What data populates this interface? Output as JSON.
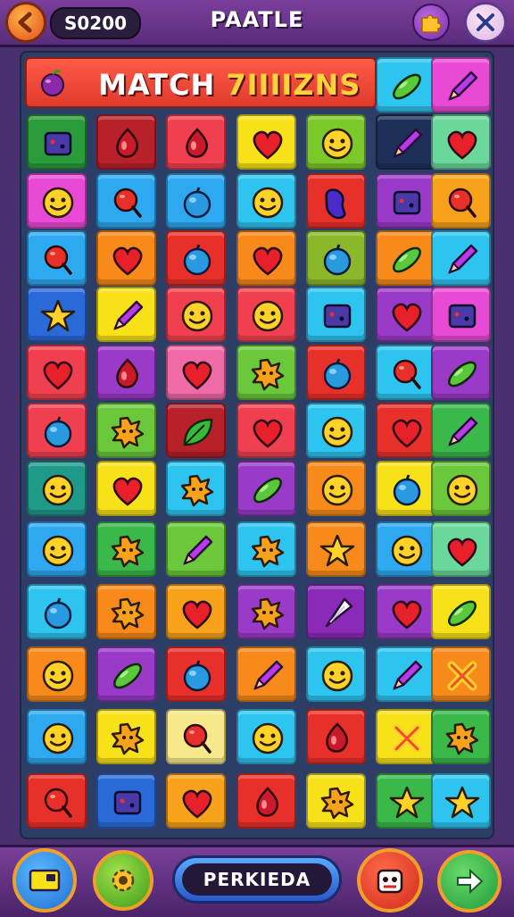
{
  "header": {
    "score": "S0200",
    "title": "PAATLE"
  },
  "banner": {
    "text_main": "MATCH",
    "text_sub": "7IIIIZNS"
  },
  "footer": {
    "pill_label": "PERKIEDA"
  },
  "board": {
    "rows": [
      [
        null,
        null,
        null,
        null,
        null,
        {
          "bg": "#2ec4f0",
          "icon": "pickle"
        },
        {
          "bg": "#e84ad6",
          "icon": "pencil"
        }
      ],
      [
        {
          "bg": "#2a9a3a",
          "icon": "box"
        },
        {
          "bg": "#b8202a",
          "icon": "drop"
        },
        {
          "bg": "#f04050",
          "icon": "drop"
        },
        {
          "bg": "#f7e21a",
          "icon": "heart"
        },
        {
          "bg": "#7ac82a",
          "icon": "smiley"
        },
        {
          "bg": "#1e2f5a",
          "icon": "pencil"
        },
        {
          "bg": "#6ad89a",
          "icon": "heart"
        }
      ],
      [
        {
          "bg": "#e84ad6",
          "icon": "smiley"
        },
        {
          "bg": "#2ea8f0",
          "icon": "lollipop"
        },
        {
          "bg": "#2ea8f0",
          "icon": "ball"
        },
        {
          "bg": "#2ec4f0",
          "icon": "smiley"
        },
        {
          "bg": "#e8302a",
          "icon": "bean"
        },
        {
          "bg": "#9a3ac8",
          "icon": "box"
        },
        {
          "bg": "#f7a21a",
          "icon": "lollipop"
        }
      ],
      [
        {
          "bg": "#2ea8f0",
          "icon": "lollipop"
        },
        {
          "bg": "#f78a1a",
          "icon": "heart"
        },
        {
          "bg": "#e8302a",
          "icon": "ball"
        },
        {
          "bg": "#f78a1a",
          "icon": "heart"
        },
        {
          "bg": "#8ab82a",
          "icon": "ball"
        },
        {
          "bg": "#f78a1a",
          "icon": "pickle"
        },
        {
          "bg": "#2ec4f0",
          "icon": "pencil"
        }
      ],
      [
        {
          "bg": "#2a6ad8",
          "icon": "star"
        },
        {
          "bg": "#f7e21a",
          "icon": "pencil"
        },
        {
          "bg": "#f04050",
          "icon": "smiley"
        },
        {
          "bg": "#f04050",
          "icon": "smiley"
        },
        {
          "bg": "#2ec4f0",
          "icon": "box"
        },
        {
          "bg": "#9a3ac8",
          "icon": "heart"
        },
        {
          "bg": "#e84ad6",
          "icon": "box"
        }
      ],
      [
        {
          "bg": "#f04050",
          "icon": "heart"
        },
        {
          "bg": "#9a3ac8",
          "icon": "drop"
        },
        {
          "bg": "#f06aa8",
          "icon": "heart"
        },
        {
          "bg": "#6ac83a",
          "icon": "splat"
        },
        {
          "bg": "#e8302a",
          "icon": "ball"
        },
        {
          "bg": "#2ec4f0",
          "icon": "lollipop"
        },
        {
          "bg": "#9a3ac8",
          "icon": "pickle"
        }
      ],
      [
        {
          "bg": "#f04050",
          "icon": "ball"
        },
        {
          "bg": "#6ac83a",
          "icon": "splat"
        },
        {
          "bg": "#b8202a",
          "icon": "leaf"
        },
        {
          "bg": "#f04050",
          "icon": "heart"
        },
        {
          "bg": "#2ec4f0",
          "icon": "smiley"
        },
        {
          "bg": "#e8302a",
          "icon": "heart"
        },
        {
          "bg": "#3ab84a",
          "icon": "pencil"
        }
      ],
      [
        {
          "bg": "#1f9a8a",
          "icon": "smiley"
        },
        {
          "bg": "#f7e21a",
          "icon": "heart"
        },
        {
          "bg": "#2ec4f0",
          "icon": "splat"
        },
        {
          "bg": "#9a3ac8",
          "icon": "pickle"
        },
        {
          "bg": "#f78a1a",
          "icon": "smiley"
        },
        {
          "bg": "#f7e21a",
          "icon": "ball"
        },
        {
          "bg": "#6ac83a",
          "icon": "smiley"
        }
      ],
      [
        {
          "bg": "#2ea8f0",
          "icon": "smiley"
        },
        {
          "bg": "#3ab84a",
          "icon": "splat"
        },
        {
          "bg": "#6ac83a",
          "icon": "pencil"
        },
        {
          "bg": "#2ec4f0",
          "icon": "splat"
        },
        {
          "bg": "#f78a1a",
          "icon": "star"
        },
        {
          "bg": "#2ea8f0",
          "icon": "smiley"
        },
        {
          "bg": "#6ad89a",
          "icon": "heart"
        }
      ],
      [
        {
          "bg": "#2ec4f0",
          "icon": "ball"
        },
        {
          "bg": "#f78a1a",
          "icon": "splat"
        },
        {
          "bg": "#f7a21a",
          "icon": "heart"
        },
        {
          "bg": "#9a3ac8",
          "icon": "splat"
        },
        {
          "bg": "#8a2ab8",
          "icon": "cone"
        },
        {
          "bg": "#9a3ac8",
          "icon": "heart"
        },
        {
          "bg": "#f7e21a",
          "icon": "pickle"
        }
      ],
      [
        {
          "bg": "#f78a1a",
          "icon": "smiley"
        },
        {
          "bg": "#9a3ac8",
          "icon": "pickle"
        },
        {
          "bg": "#e8302a",
          "icon": "ball"
        },
        {
          "bg": "#f78a1a",
          "icon": "pencil"
        },
        {
          "bg": "#2ec4f0",
          "icon": "smiley"
        },
        {
          "bg": "#2ec4f0",
          "icon": "pencil"
        },
        {
          "bg": "#f78a1a",
          "icon": "cross"
        }
      ],
      [
        {
          "bg": "#2ea8f0",
          "icon": "smiley"
        },
        {
          "bg": "#f7e21a",
          "icon": "splat"
        },
        {
          "bg": "#f7e88a",
          "icon": "lollipop"
        },
        {
          "bg": "#2ec4f0",
          "icon": "smiley"
        },
        {
          "bg": "#e8302a",
          "icon": "drop"
        },
        {
          "bg": "#f7e21a",
          "icon": "cross"
        },
        {
          "bg": "#3ab84a",
          "icon": "splat"
        }
      ],
      [
        {
          "bg": "#e8302a",
          "icon": "lollipop"
        },
        {
          "bg": "#2a6ad8",
          "icon": "box"
        },
        {
          "bg": "#f7a21a",
          "icon": "heart"
        },
        {
          "bg": "#e8302a",
          "icon": "drop"
        },
        {
          "bg": "#f7e21a",
          "icon": "splat"
        },
        {
          "bg": "#3ab84a",
          "icon": "star"
        },
        {
          "bg": "#2ec4f0",
          "icon": "star"
        }
      ]
    ]
  }
}
